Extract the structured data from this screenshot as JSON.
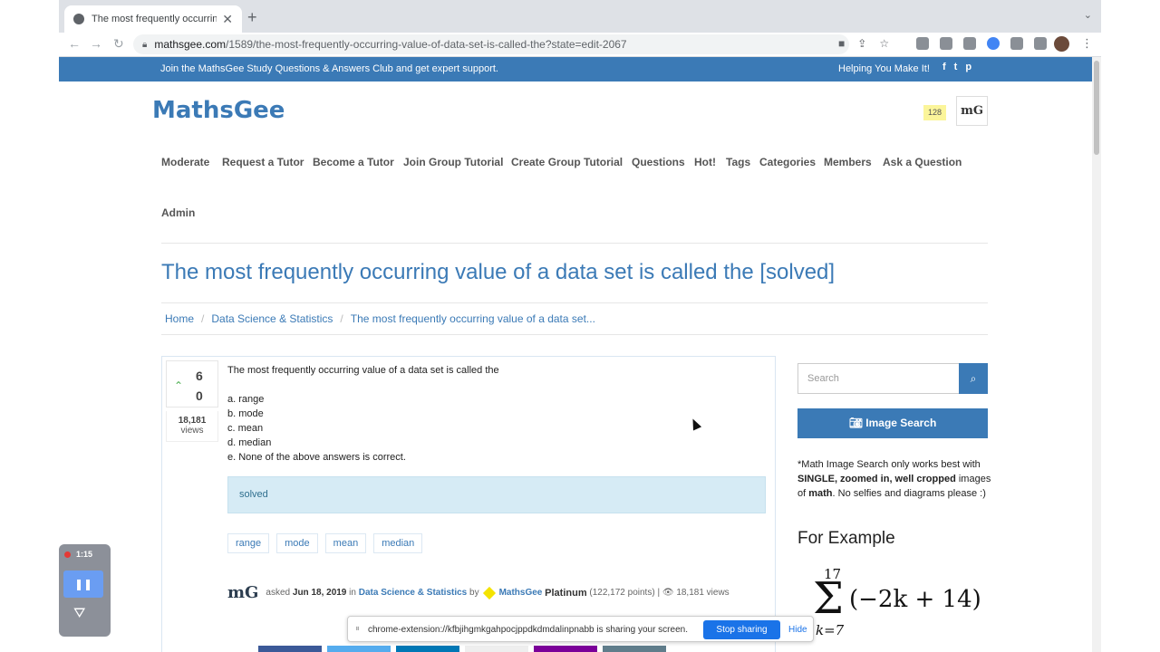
{
  "browser": {
    "tab_title": "The most frequently occurring",
    "url_domain": "mathsgee.com",
    "url_path": "/1589/the-most-frequently-occurring-value-of-data-set-is-called-the?state=edit-2067"
  },
  "topbar": {
    "message": "Join the MathsGee Study Questions & Answers Club and get expert support.",
    "tagline": "Helping You Make It!",
    "social": [
      "f",
      "t",
      "p"
    ]
  },
  "header": {
    "logo": "MathsGee",
    "points_badge": "128",
    "avatar_text": "mG"
  },
  "nav": {
    "items": [
      "Moderate",
      "Request a Tutor",
      "Become a Tutor",
      "Join Group Tutorial",
      "Create Group Tutorial",
      "Questions",
      "Hot!",
      "Tags",
      "Categories",
      "Members",
      "Ask a Question",
      "Admin"
    ]
  },
  "page": {
    "title": "The most frequently occurring value of a data set is called the [solved]",
    "breadcrumbs": [
      "Home",
      "Data Science & Statistics",
      "The most frequently occurring value of a data set..."
    ]
  },
  "question": {
    "votes_up": "6",
    "votes_down": "0",
    "views_count": "18,181",
    "views_label": "views",
    "text": "The most frequently occurring value of a data set is called the",
    "options": [
      "a. range",
      "b. mode",
      "c. mean",
      "d. median",
      "e. None of the above answers is correct."
    ],
    "status": "solved",
    "tags": [
      "range",
      "mode",
      "mean",
      "median"
    ],
    "meta": {
      "avatar": "mG",
      "asked": "asked",
      "date": "Jun 18, 2019",
      "in": "in",
      "category": "Data Science & Statistics",
      "by": "by",
      "author": "MathsGee",
      "level": "Platinum",
      "points": "(122,172 points)",
      "views": "18,181 views"
    }
  },
  "sidebar": {
    "search_placeholder": "Search",
    "image_search_label": "Image Search",
    "note_part1": "*Math Image Search only works best with ",
    "note_bold1": "SINGLE, zoomed in, well cropped",
    "note_part2": " images of ",
    "note_bold2": "math",
    "note_part3": ". No selfies and diagrams please :)",
    "example_heading": "For Example",
    "formula_upper": "17",
    "formula_lower": "k=7",
    "formula_expr": "(−2k + 14)"
  },
  "share_notice": {
    "text": "chrome-extension://kfbjihgmkgahpocjppdkdmdalinpnabb is sharing your screen.",
    "stop_label": "Stop sharing",
    "hide_label": "Hide"
  },
  "recorder": {
    "time": "1:15"
  },
  "colors": {
    "brand": "#3b7ab6",
    "solved_bg": "#d6ebf5",
    "badge": "#fbf59a"
  }
}
